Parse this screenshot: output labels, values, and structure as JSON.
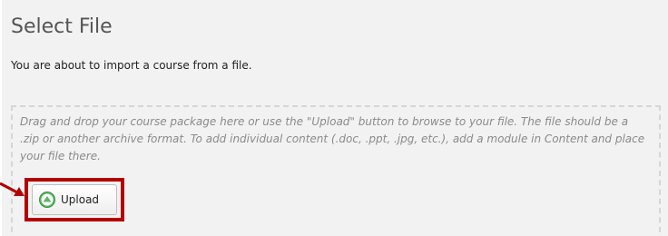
{
  "page": {
    "title": "Select File",
    "subtitle": "You are about to import a course from a file."
  },
  "dropzone": {
    "instructions": "Drag and drop your course package here or use the \"Upload\" button to browse to your file. The file should be a .zip or another archive format. To add individual content (.doc, .ppt, .jpg, etc.), add a module in Content and place your file there."
  },
  "upload_button": {
    "label": "Upload",
    "icon": "upload-icon"
  },
  "colors": {
    "highlight": "#b30000",
    "upload_icon": "#4fae57",
    "panel_background": "#f2f2f2"
  }
}
